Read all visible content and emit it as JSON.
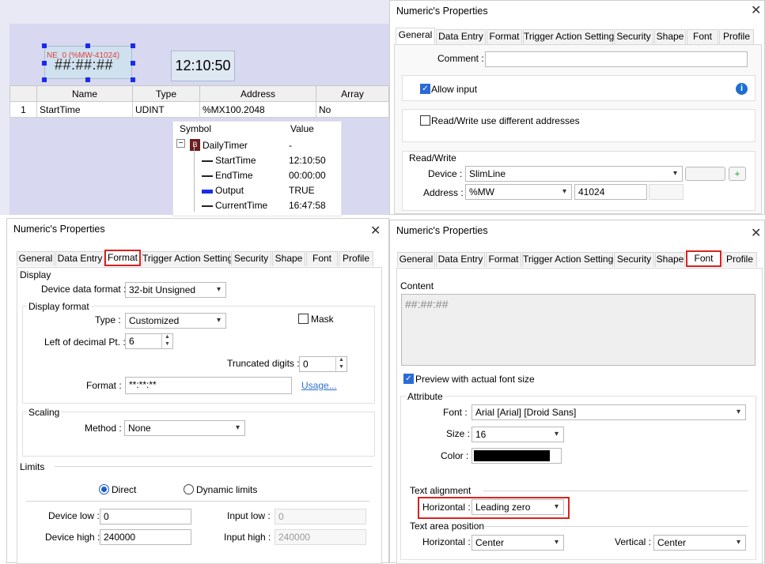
{
  "canvas": {
    "numeric_object": {
      "address_label": "NE_0 (%MW-41024)",
      "value_mask": "##:##:##"
    },
    "time_object": {
      "value": "12:10:50"
    }
  },
  "variable_table": {
    "headers": [
      "Name",
      "Type",
      "Address",
      "Array"
    ],
    "rows": [
      {
        "index": "1",
        "name": "StartTime",
        "type": "UDINT",
        "address": "%MX100.2048",
        "array": "No"
      }
    ]
  },
  "symbol_panel": {
    "headers": {
      "symbol": "Symbol",
      "value": "Value"
    },
    "root": {
      "expander": "−",
      "name": "DailyTimer",
      "value": "-"
    },
    "children": [
      {
        "name": "StartTime",
        "value": "12:10:50"
      },
      {
        "name": "EndTime",
        "value": "00:00:00"
      },
      {
        "name": "Output",
        "value": "TRUE"
      },
      {
        "name": "CurrentTime",
        "value": "16:47:58"
      }
    ]
  },
  "dialog_general": {
    "title": "Numeric's Properties",
    "close": "✕",
    "tabs": [
      "General",
      "Data Entry",
      "Format",
      "Trigger Action Setting",
      "Security",
      "Shape",
      "Font",
      "Profile"
    ],
    "comment_label": "Comment :",
    "comment_value": "",
    "allow_input_label": "Allow input",
    "info_icon": "i",
    "rw_diff_label": "Read/Write use different addresses",
    "rw_group_label": "Read/Write",
    "device_label": "Device :",
    "device_value": "SlimLine",
    "address_label": "Address :",
    "address_type": "%MW",
    "address_value": "41024"
  },
  "dialog_format": {
    "title": "Numeric's Properties",
    "close": "✕",
    "tabs": [
      "General",
      "Data Entry",
      "Format",
      "Trigger Action Setting",
      "Security",
      "Shape",
      "Font",
      "Profile"
    ],
    "display_label": "Display",
    "device_data_format_label": "Device data format :",
    "device_data_format_value": "32-bit Unsigned",
    "display_format_label": "Display format",
    "type_label": "Type :",
    "type_value": "Customized",
    "mask_label": "Mask",
    "left_decimal_label": "Left of decimal Pt. :",
    "left_decimal_value": "6",
    "truncated_label": "Truncated digits :",
    "truncated_value": "0",
    "format_label": "Format :",
    "format_value": "**:**:**",
    "usage_link": "Usage...",
    "scaling_label": "Scaling",
    "method_label": "Method :",
    "method_value": "None",
    "limits_label": "Limits",
    "direct_label": "Direct",
    "dynamic_label": "Dynamic limits",
    "device_low_label": "Device low :",
    "device_low_value": "0",
    "device_high_label": "Device high :",
    "device_high_value": "240000",
    "input_low_label": "Input low :",
    "input_low_value": "0",
    "input_high_label": "Input high :",
    "input_high_value": "240000"
  },
  "dialog_font": {
    "title": "Numeric's Properties",
    "close": "✕",
    "tabs": [
      "General",
      "Data Entry",
      "Format",
      "Trigger Action Setting",
      "Security",
      "Shape",
      "Font",
      "Profile"
    ],
    "content_label": "Content",
    "content_value": "##:##:##",
    "preview_label": "Preview with actual font size",
    "attribute_label": "Attribute",
    "font_label": "Font :",
    "font_value": "Arial [Arial] [Droid Sans]",
    "size_label": "Size :",
    "size_value": "16",
    "color_label": "Color :",
    "text_alignment_label": "Text alignment",
    "horizontal_label": "Horizontal :",
    "horizontal_value": "Leading zero",
    "text_area_label": "Text area position",
    "area_horizontal_label": "Horizontal :",
    "area_horizontal_value": "Center",
    "area_vertical_label": "Vertical :",
    "area_vertical_value": "Center"
  },
  "colors": {
    "highlight_red": "#d9221f",
    "selection_blue": "#1b2be8",
    "checkbox_blue": "#2b6bd6"
  },
  "icons": {
    "dropdown": "▾",
    "check": "✓",
    "spin_up": "▲",
    "spin_down": "▼"
  }
}
